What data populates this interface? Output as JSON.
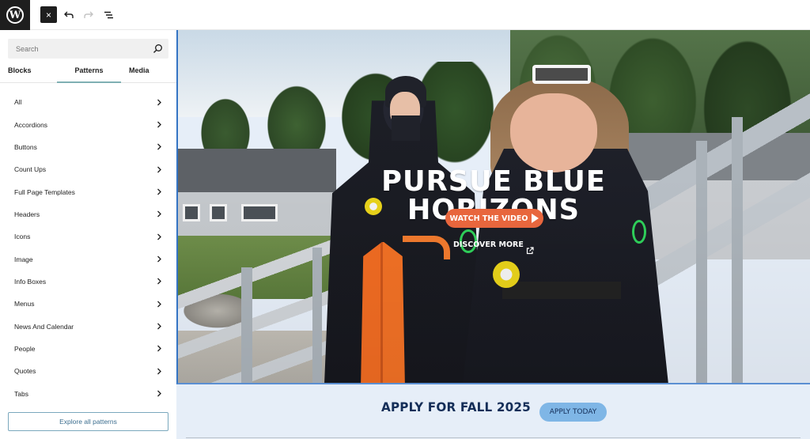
{
  "toolbar": {
    "logo": "W",
    "close_label": "×",
    "icons": [
      "wordpress-logo",
      "close-icon",
      "undo-icon",
      "redo-icon",
      "document-overview-icon"
    ]
  },
  "inserter": {
    "search": {
      "placeholder": "Search",
      "value": ""
    },
    "tabs": [
      {
        "label": "Blocks",
        "active": false
      },
      {
        "label": "Patterns",
        "active": true
      },
      {
        "label": "Media",
        "active": false
      }
    ],
    "categories": [
      {
        "label": "All"
      },
      {
        "label": "Accordions"
      },
      {
        "label": "Buttons"
      },
      {
        "label": "Count Ups"
      },
      {
        "label": "Full Page Templates"
      },
      {
        "label": "Headers"
      },
      {
        "label": "Icons"
      },
      {
        "label": "Image"
      },
      {
        "label": "Info Boxes"
      },
      {
        "label": "Menus"
      },
      {
        "label": "News And Calendar"
      },
      {
        "label": "People"
      },
      {
        "label": "Quotes"
      },
      {
        "label": "Tabs"
      }
    ],
    "explore_label": "Explore all patterns"
  },
  "hero": {
    "title": "PURSUE BLUE HORIZONS",
    "watch_label": "WATCH THE VIDEO",
    "discover_label": "DISCOVER MORE"
  },
  "cta": {
    "title": "APPLY FOR FALL 2025",
    "button_label": "APPLY TODAY"
  },
  "colors": {
    "accent_orange": "#e8663d",
    "navy": "#142e58",
    "apply_blue": "#7fb6e6",
    "cta_background": "#e6eef8",
    "selection_blue": "#3474c4",
    "tab_underline": "#7fb0b3"
  }
}
